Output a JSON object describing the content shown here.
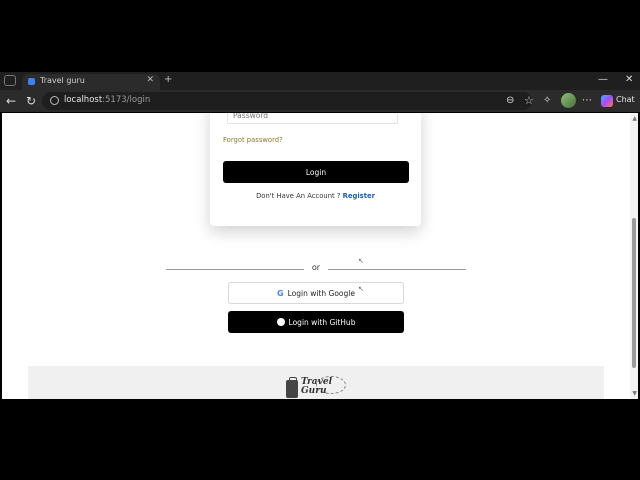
{
  "browser": {
    "tab_title": "Travel guru",
    "tab_close": "✕",
    "new_tab": "+",
    "window_minimize": "—",
    "window_close": "✕",
    "url_host": "localhost",
    "url_path": ":5173/login",
    "copilot_label": "Chat"
  },
  "login_card": {
    "password_placeholder": "Password",
    "forgot_password": "Forgot password?",
    "login_button": "Login",
    "no_account_text": "Don't Have An Account ?",
    "register_link": "Register"
  },
  "social": {
    "or_label": "or",
    "google_button": "Login with Google",
    "github_button": "Login with GitHub"
  },
  "footer": {
    "logo_line1": "Travel",
    "logo_line2": "Guru"
  }
}
